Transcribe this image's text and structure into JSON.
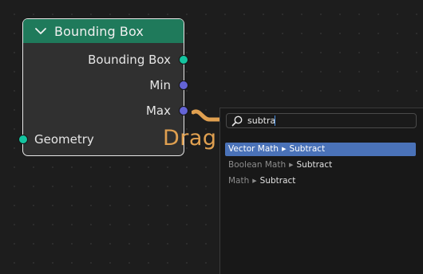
{
  "node": {
    "title": "Bounding Box",
    "outputs": [
      {
        "label": "Bounding Box",
        "type": "geometry"
      },
      {
        "label": "Min",
        "type": "vector"
      },
      {
        "label": "Max",
        "type": "vector"
      }
    ],
    "inputs": [
      {
        "label": "Geometry",
        "type": "geometry"
      }
    ],
    "header_color": "#1f7a5b",
    "geometry_socket_color": "#14c4a0",
    "vector_socket_color": "#6464d6"
  },
  "drag_hint": "Drag",
  "search": {
    "value": "subtra",
    "results": [
      {
        "path": "Vector Math",
        "leaf": "Subtract",
        "selected": true
      },
      {
        "path": "Boolean Math",
        "leaf": "Subtract",
        "selected": false
      },
      {
        "path": "Math",
        "leaf": "Subtract",
        "selected": false
      }
    ]
  }
}
